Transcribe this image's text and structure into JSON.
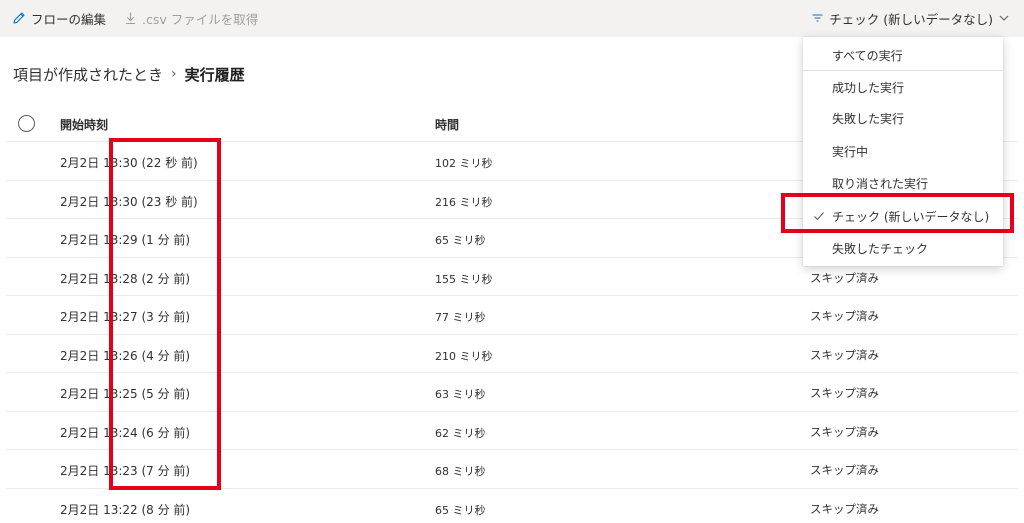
{
  "toolbar": {
    "edit_flow": "フローの編集",
    "get_csv": ".csv ファイルを取得",
    "filter": "チェック (新しいデータなし)"
  },
  "breadcrumb": {
    "root": "項目が作成されたとき",
    "separator": "›",
    "current": "実行履歴"
  },
  "table": {
    "headers": {
      "start": "開始時刻",
      "duration": "時間"
    },
    "rows": [
      {
        "start": "2月2日 13:30 (22 秒 前)",
        "duration": "102 ミリ秒",
        "status": ""
      },
      {
        "start": "2月2日 13:30 (23 秒 前)",
        "duration": "216 ミリ秒",
        "status": ""
      },
      {
        "start": "2月2日 13:29 (1 分 前)",
        "duration": "65 ミリ秒",
        "status": ""
      },
      {
        "start": "2月2日 13:28 (2 分 前)",
        "duration": "155 ミリ秒",
        "status": "スキップ済み"
      },
      {
        "start": "2月2日 13:27 (3 分 前)",
        "duration": "77 ミリ秒",
        "status": "スキップ済み"
      },
      {
        "start": "2月2日 13:26 (4 分 前)",
        "duration": "210 ミリ秒",
        "status": "スキップ済み"
      },
      {
        "start": "2月2日 13:25 (5 分 前)",
        "duration": "63 ミリ秒",
        "status": "スキップ済み"
      },
      {
        "start": "2月2日 13:24 (6 分 前)",
        "duration": "62 ミリ秒",
        "status": "スキップ済み"
      },
      {
        "start": "2月2日 13:23 (7 分 前)",
        "duration": "68 ミリ秒",
        "status": "スキップ済み"
      },
      {
        "start": "2月2日 13:22 (8 分 前)",
        "duration": "65 ミリ秒",
        "status": "スキップ済み"
      }
    ]
  },
  "dropdown": {
    "items": [
      {
        "label": "すべての実行",
        "checked": false
      },
      {
        "label": "成功した実行",
        "checked": false
      },
      {
        "label": "失敗した実行",
        "checked": false
      },
      {
        "label": "実行中",
        "checked": false
      },
      {
        "label": "取り消された実行",
        "checked": false
      },
      {
        "label": "チェック (新しいデータなし)",
        "checked": true
      },
      {
        "label": "失敗したチェック",
        "checked": false
      }
    ]
  },
  "colors": {
    "accent": "#0078d4",
    "highlight": "#e5001a",
    "toolbar_bg": "#f3f2f1"
  },
  "icons": {
    "edit": "pencil-icon",
    "download": "download-icon",
    "filter": "filter-icon",
    "chevron": "chevron-down-icon",
    "check": "checkmark-icon"
  }
}
